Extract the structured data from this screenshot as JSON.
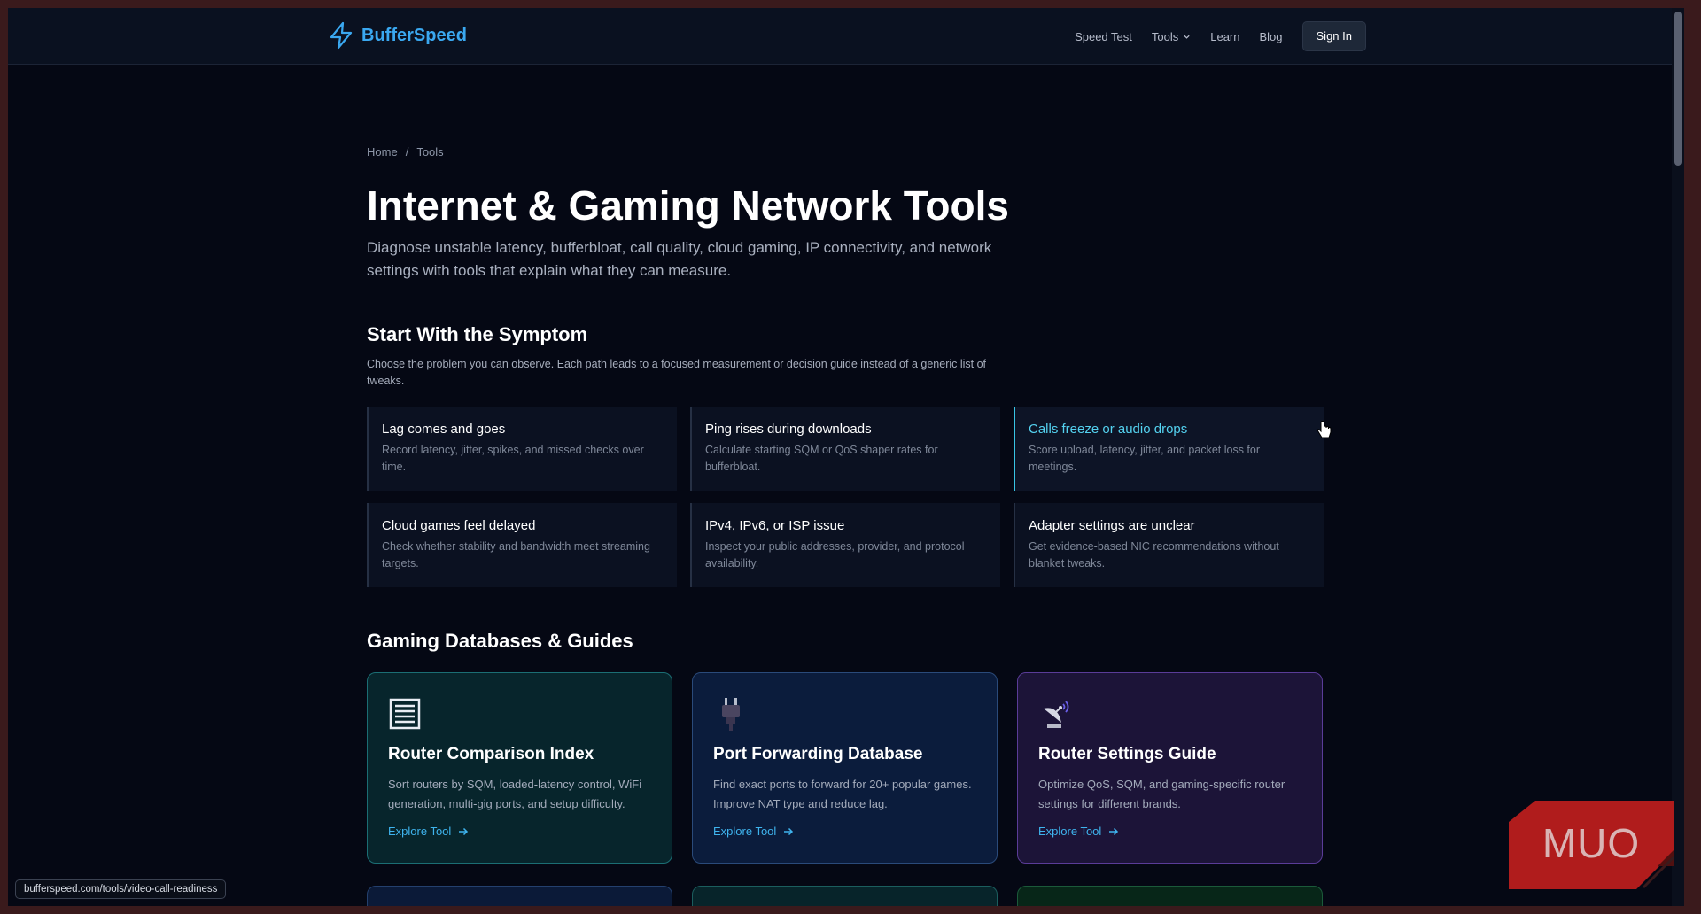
{
  "brand": {
    "name": "BufferSpeed",
    "logo_icon": "lightning-bolt-icon",
    "accent": "#3aa8f0"
  },
  "nav": {
    "speed_test": "Speed Test",
    "tools": "Tools",
    "learn": "Learn",
    "blog": "Blog",
    "sign_in": "Sign In"
  },
  "breadcrumb": {
    "home": "Home",
    "separator": "/",
    "current": "Tools"
  },
  "hero": {
    "title": "Internet & Gaming Network Tools",
    "description": "Diagnose unstable latency, bufferbloat, call quality, cloud gaming, IP connectivity, and network settings with tools that explain what they can measure."
  },
  "symptoms": {
    "heading": "Start With the Symptom",
    "subheading": "Choose the problem you can observe. Each path leads to a focused measurement or decision guide instead of a generic list of tweaks.",
    "items": [
      {
        "title": "Lag comes and goes",
        "desc": "Record latency, jitter, spikes, and missed checks over time."
      },
      {
        "title": "Ping rises during downloads",
        "desc": "Calculate starting SQM or QoS shaper rates for bufferbloat."
      },
      {
        "title": "Calls freeze or audio drops",
        "desc": "Score upload, latency, jitter, and packet loss for meetings."
      },
      {
        "title": "Cloud games feel delayed",
        "desc": "Check whether stability and bandwidth meet streaming targets."
      },
      {
        "title": "IPv4, IPv6, or ISP issue",
        "desc": "Inspect your public addresses, provider, and protocol availability."
      },
      {
        "title": "Adapter settings are unclear",
        "desc": "Get evidence-based NIC recommendations without blanket tweaks."
      }
    ]
  },
  "gaming": {
    "heading": "Gaming Databases & Guides",
    "cards": [
      {
        "icon": "ledger-icon",
        "title": "Router Comparison Index",
        "desc": "Sort routers by SQM, loaded-latency control, WiFi generation, multi-gig ports, and setup difficulty.",
        "link": "Explore Tool"
      },
      {
        "icon": "plug-icon",
        "title": "Port Forwarding Database",
        "desc": "Find exact ports to forward for 20+ popular games. Improve NAT type and reduce lag.",
        "link": "Explore Tool"
      },
      {
        "icon": "satellite-dish-icon",
        "title": "Router Settings Guide",
        "desc": "Optimize QoS, SQM, and gaming-specific router settings for different brands.",
        "link": "Explore Tool"
      }
    ]
  },
  "status_url": "bufferspeed.com/tools/video-call-readiness",
  "watermark": "MUO"
}
